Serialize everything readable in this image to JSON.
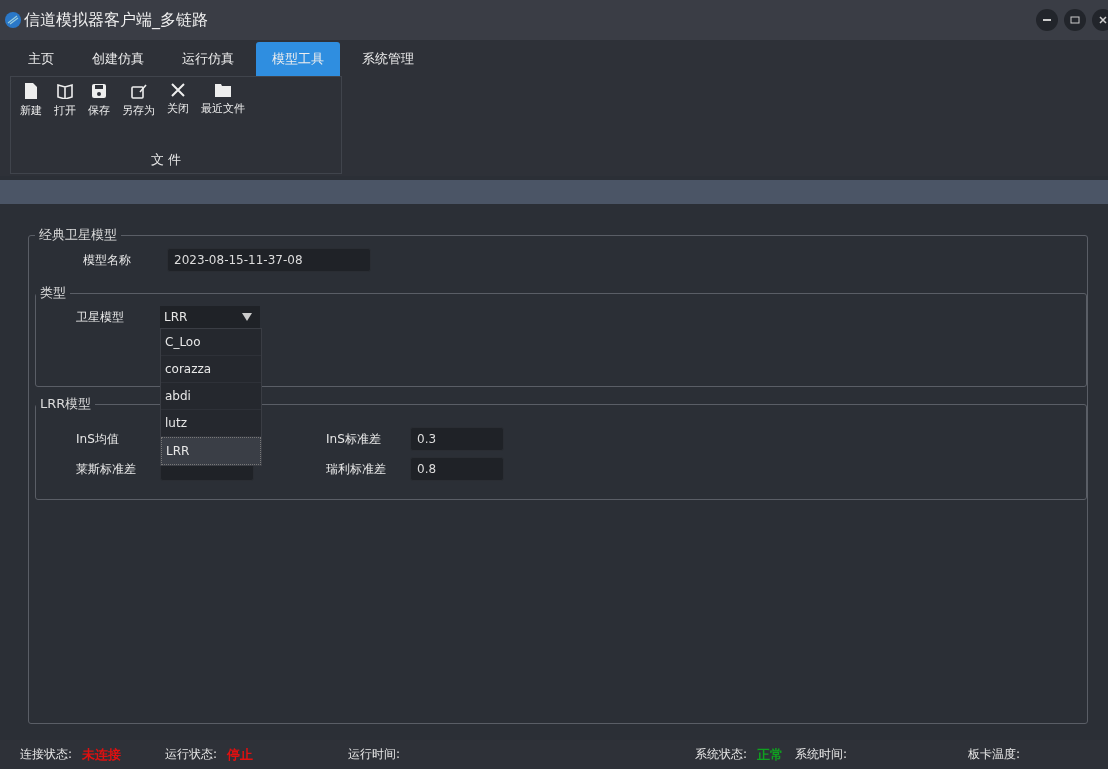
{
  "window": {
    "title": "信道模拟器客户端_多链路"
  },
  "tabs": [
    {
      "label": "主页",
      "selected": false
    },
    {
      "label": "创建仿真",
      "selected": false
    },
    {
      "label": "运行仿真",
      "selected": false
    },
    {
      "label": "模型工具",
      "selected": true
    },
    {
      "label": "系统管理",
      "selected": false
    }
  ],
  "toolbar": {
    "group": "文 件",
    "buttons": [
      {
        "kind": "new",
        "label": "新建"
      },
      {
        "kind": "open",
        "label": "打开"
      },
      {
        "kind": "save",
        "label": "保存"
      },
      {
        "kind": "saveas",
        "label": "另存为"
      },
      {
        "kind": "close",
        "label": "关闭"
      },
      {
        "kind": "recent",
        "label": "最近文件"
      }
    ]
  },
  "model_group": {
    "title": "经典卫星模型",
    "name_label": "模型名称",
    "name_value": "2023-08-15-11-37-08",
    "type_group": {
      "title": "类型",
      "label": "卫星模型",
      "value": "LRR",
      "options": [
        {
          "label": "C_Loo",
          "selected": false
        },
        {
          "label": "corazza",
          "selected": false
        },
        {
          "label": "abdi",
          "selected": false
        },
        {
          "label": "lutz",
          "selected": false
        },
        {
          "label": "LRR",
          "selected": true
        }
      ]
    },
    "lrr_group": {
      "title": "LRR模型",
      "fields": [
        {
          "label": "InS均值"
        },
        {
          "label": "InS标准差",
          "value": "0.3"
        },
        {
          "label": "莱斯标准差"
        },
        {
          "label": "瑞利标准差",
          "value": "0.8"
        }
      ]
    }
  },
  "status_bar": [
    {
      "label": "连接状态:",
      "value": "未连接",
      "color": "#e01010"
    },
    {
      "label": "运行状态:",
      "value": "停止",
      "color": "#e01010"
    },
    {
      "label": "运行时间:"
    },
    {
      "label": "系统状态:",
      "value": "正常",
      "color": "#10a020"
    },
    {
      "label": "系统时间:"
    },
    {
      "label": "板卡温度:"
    }
  ]
}
